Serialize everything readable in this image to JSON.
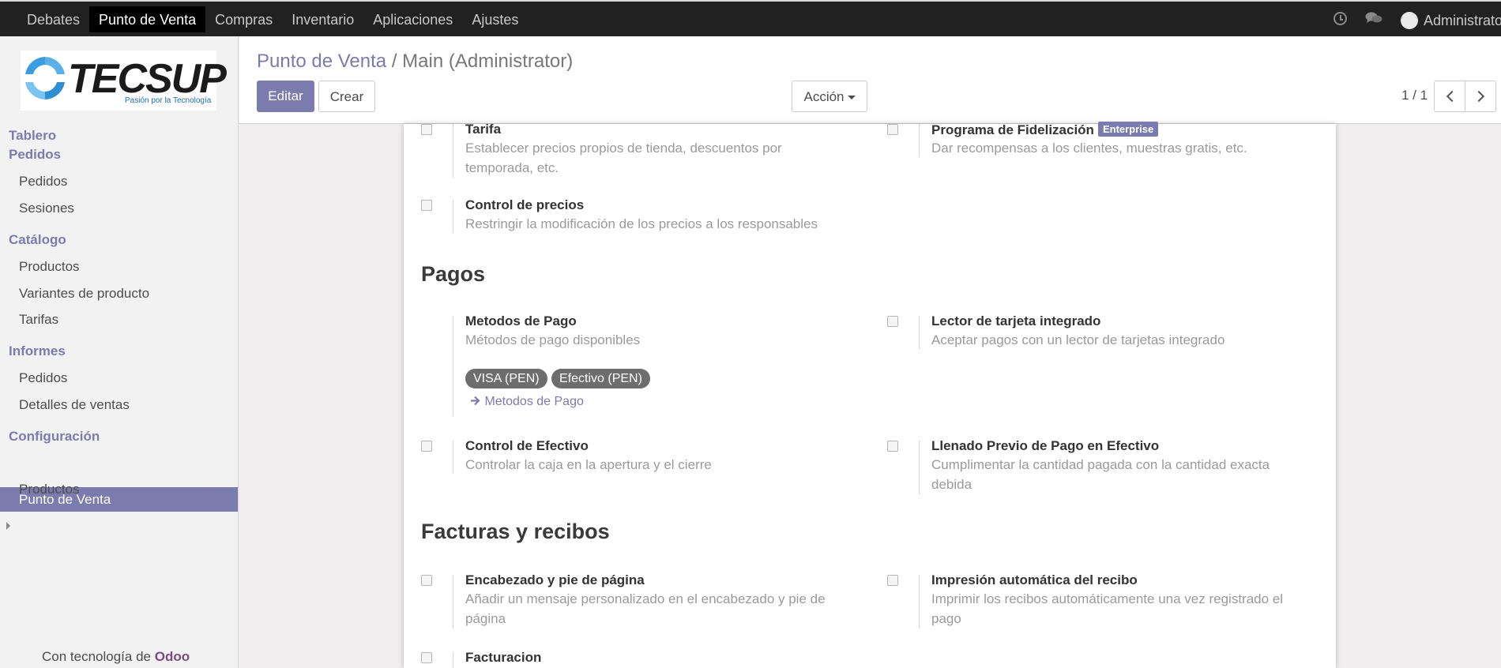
{
  "topbar": {
    "menu": [
      "Debates",
      "Punto de Venta",
      "Compras",
      "Inventario",
      "Aplicaciones",
      "Ajustes"
    ],
    "user": "Administrator"
  },
  "sidebar": {
    "logo_text": "TECSUP",
    "logo_tagline": "Pasión por la Tecnología",
    "dashboard": "Tablero",
    "orders_head": "Pedidos",
    "orders": [
      "Pedidos",
      "Sesiones"
    ],
    "catalog_head": "Catálogo",
    "catalog": [
      "Productos",
      "Variantes de producto",
      "Tarifas"
    ],
    "reports_head": "Informes",
    "reports": [
      "Pedidos",
      "Detalles de ventas"
    ],
    "config_head": "Configuración",
    "config_active": "Punto de Venta",
    "config_products": "Productos",
    "powered_prefix": "Con tecnología de",
    "powered_brand": "Odoo"
  },
  "control_panel": {
    "breadcrumb_link": "Punto de Venta",
    "breadcrumb_sep": "/",
    "breadcrumb_current": "Main (Administrator)",
    "edit": "Editar",
    "create": "Crear",
    "action": "Acción",
    "pager": "1 / 1"
  },
  "sheet": {
    "pricelist": {
      "title": "Tarifa",
      "desc": "Establecer precios propios de tienda, descuentos por temporada, etc."
    },
    "loyalty": {
      "title": "Programa de Fidelización",
      "badge": "Enterprise",
      "desc": "Dar recompensas a los clientes, muestras gratis, etc."
    },
    "price_control": {
      "title": "Control de precios",
      "desc": "Restringir la modificación de los precios a los responsables"
    },
    "payments_title": "Pagos",
    "payment_methods": {
      "title": "Metodos de Pago",
      "desc": "Métodos de pago disponibles",
      "tags": [
        "VISA (PEN)",
        "Efectivo (PEN)"
      ],
      "link": "Metodos de Pago"
    },
    "card_reader": {
      "title": "Lector de tarjeta integrado",
      "desc": "Aceptar pagos con un lector de tarjetas integrado"
    },
    "cash_control": {
      "title": "Control de Efectivo",
      "desc": "Controlar la caja en la apertura y el cierre"
    },
    "cash_prefill": {
      "title": "Llenado Previo de Pago en Efectivo",
      "desc": "Cumplimentar la cantidad pagada con la cantidad exacta debida"
    },
    "invoices_title": "Facturas y recibos",
    "header_footer": {
      "title": "Encabezado y pie de página",
      "desc": "Añadir un mensaje personalizado en el encabezado y pie de página"
    },
    "auto_print": {
      "title": "Impresión automática del recibo",
      "desc": "Imprimir los recibos automáticamente una vez registrado el pago"
    },
    "invoicing": {
      "title": "Facturacion"
    }
  }
}
